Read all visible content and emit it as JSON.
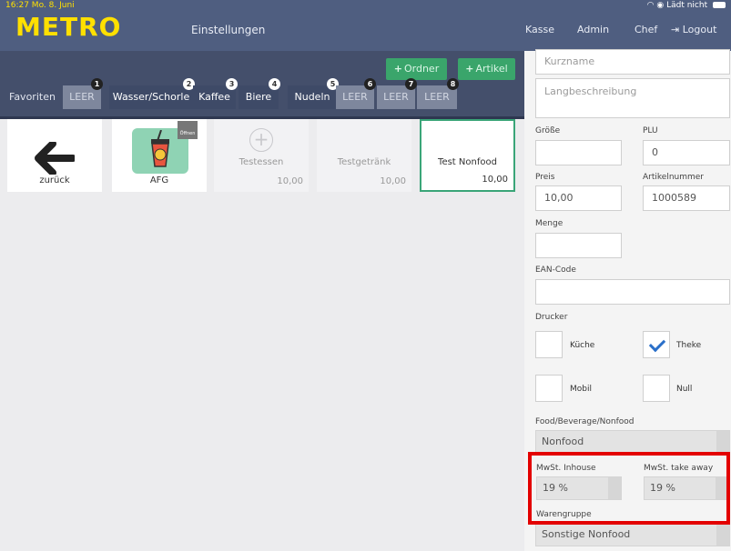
{
  "status": {
    "time_date": "16:27  Mo. 8. Juni",
    "battery_text": "Lädt nicht"
  },
  "header": {
    "logo": "METRO",
    "title": "Einstellungen",
    "nav": [
      "Kasse",
      "Admin",
      "Chef"
    ],
    "logout": "Logout"
  },
  "toolbar": {
    "ordner_label": "Ordner",
    "artikel_label": "Artikel"
  },
  "favorites": {
    "label": "Favoriten",
    "tabs": [
      {
        "badge": "1",
        "label": "LEER"
      },
      {
        "badge": "2",
        "label": "Wasser/Schorle"
      },
      {
        "badge": "3",
        "label": "Kaffee"
      },
      {
        "badge": "4",
        "label": "Biere"
      },
      {
        "badge": "5",
        "label": "Nudeln"
      },
      {
        "badge": "6",
        "label": "LEER"
      },
      {
        "badge": "7",
        "label": "LEER"
      },
      {
        "badge": "8",
        "label": "LEER"
      }
    ]
  },
  "tiles": [
    {
      "label": "zurück"
    },
    {
      "label": "AFG",
      "folder_badge": "Öffnen"
    },
    {
      "label": "Testessen",
      "price": "10,00"
    },
    {
      "label": "Testgetränk",
      "price": "10,00"
    },
    {
      "label": "Test Nonfood",
      "price": "10,00"
    }
  ],
  "form": {
    "kurzname_placeholder": "Kurzname",
    "langbeschreibung_placeholder": "Langbeschreibung",
    "groesse_label": "Größe",
    "groesse_value": "",
    "plu_label": "PLU",
    "plu_value": "0",
    "preis_label": "Preis",
    "preis_value": "10,00",
    "artikelnummer_label": "Artikelnummer",
    "artikelnummer_value": "1000589",
    "menge_label": "Menge",
    "menge_value": "",
    "ean_label": "EAN-Code",
    "ean_value": "",
    "drucker_label": "Drucker",
    "drucker": [
      {
        "label": "Küche",
        "checked": false
      },
      {
        "label": "Theke",
        "checked": true
      },
      {
        "label": "Mobil",
        "checked": false
      },
      {
        "label": "Null",
        "checked": false
      }
    ],
    "food_label": "Food/Beverage/Nonfood",
    "food_value": "Nonfood",
    "mwst_inhouse_label": "MwSt. Inhouse",
    "mwst_inhouse_value": "19 %",
    "mwst_takeaway_label": "MwSt. take away",
    "mwst_takeaway_value": "19 %",
    "warengruppe_label": "Warengruppe",
    "warengruppe_value": "Sonstige Nonfood"
  },
  "colors": {
    "header": "#4f5e80",
    "toolbar": "#444f6b",
    "accent_green": "#3aa56b",
    "logo_yellow": "#ffe000",
    "highlight_red": "#e30000"
  }
}
